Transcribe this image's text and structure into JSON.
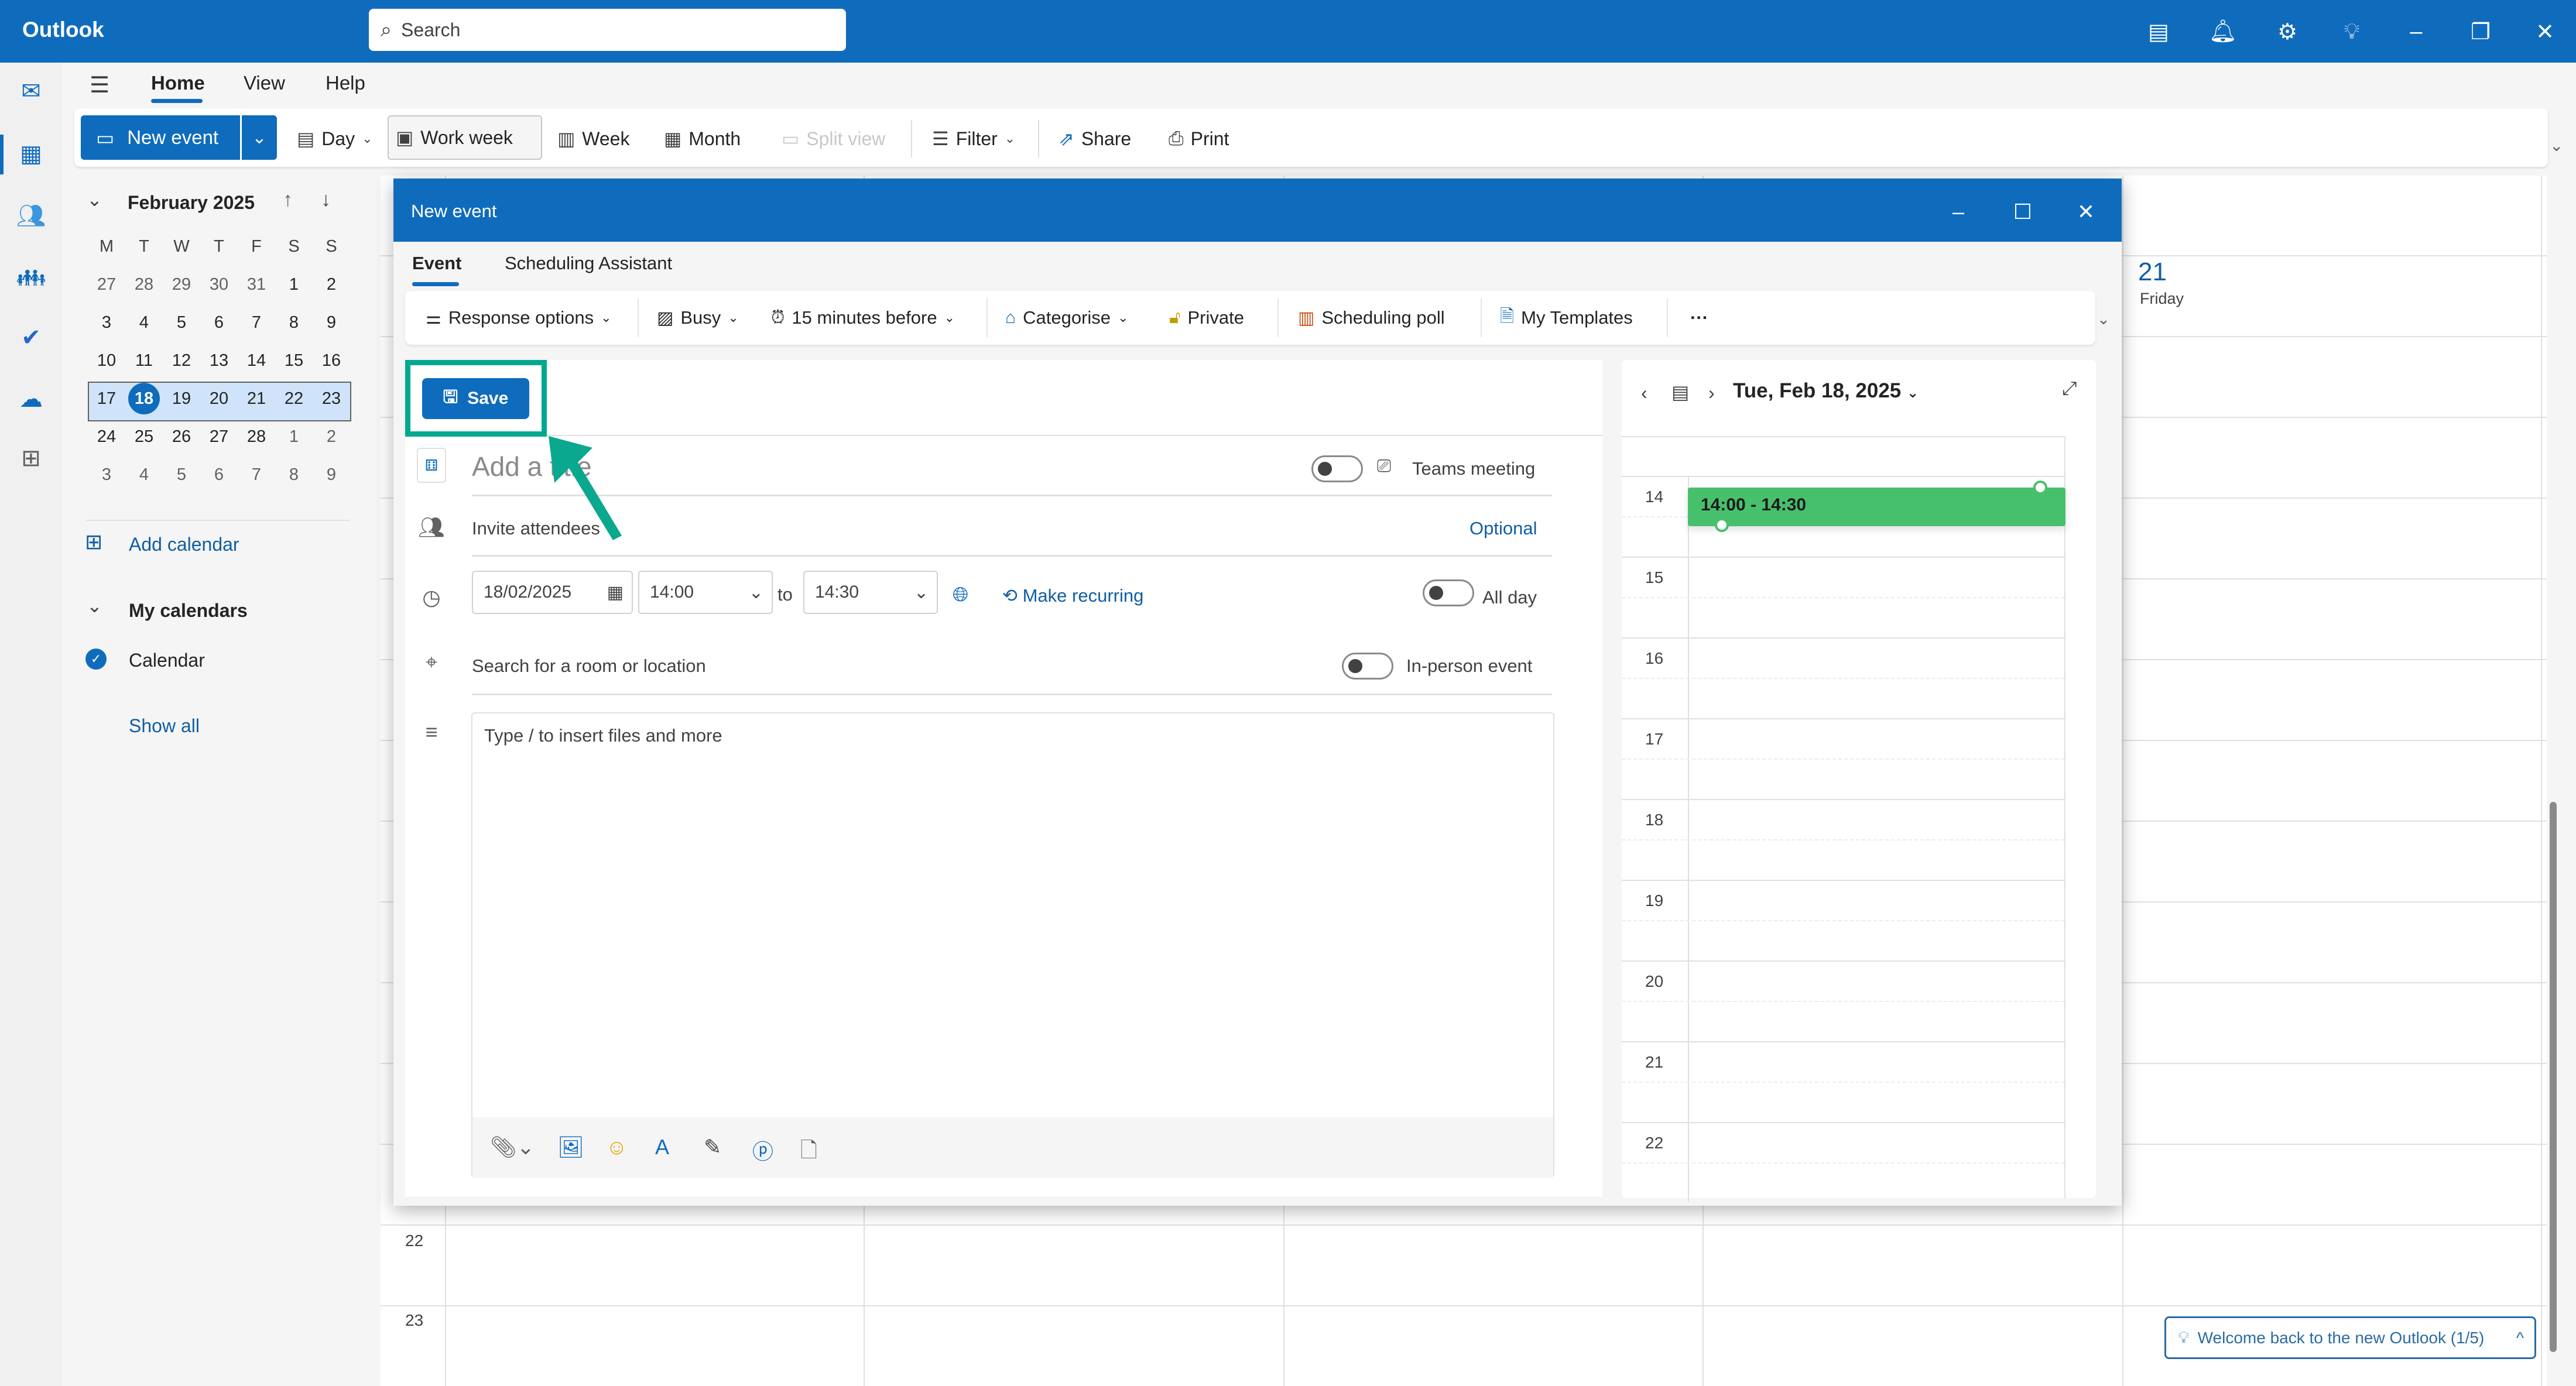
{
  "app": {
    "title": "Outlook",
    "search_placeholder": "Search"
  },
  "titlebar_icons": [
    "my-day-icon",
    "bell-icon",
    "gear-icon",
    "lightbulb-icon",
    "minimize-icon",
    "restore-icon",
    "close-icon"
  ],
  "nav": {
    "tabs": [
      "Home",
      "View",
      "Help"
    ],
    "active": "Home"
  },
  "ribbon": {
    "new_event": "New event",
    "day": "Day",
    "work_week": "Work week",
    "week": "Week",
    "month": "Month",
    "split_view": "Split view",
    "filter": "Filter",
    "share": "Share",
    "print": "Print"
  },
  "mini_calendar": {
    "month_label": "February 2025",
    "weekdays": [
      "M",
      "T",
      "W",
      "T",
      "F",
      "S",
      "S"
    ],
    "weeks": [
      [
        "27",
        "28",
        "29",
        "30",
        "31",
        "1",
        "2"
      ],
      [
        "3",
        "4",
        "5",
        "6",
        "7",
        "8",
        "9"
      ],
      [
        "10",
        "11",
        "12",
        "13",
        "14",
        "15",
        "16"
      ],
      [
        "17",
        "18",
        "19",
        "20",
        "21",
        "22",
        "23"
      ],
      [
        "24",
        "25",
        "26",
        "27",
        "28",
        "1",
        "2"
      ],
      [
        "3",
        "4",
        "5",
        "6",
        "7",
        "8",
        "9"
      ]
    ],
    "today": "18",
    "selected_week_index": 3
  },
  "sidebar": {
    "add_calendar": "Add calendar",
    "my_calendars": "My calendars",
    "calendar_item": "Calendar",
    "show_all": "Show all"
  },
  "background_calendar": {
    "day_number": "21",
    "day_name": "Friday",
    "hours": [
      "22",
      "23"
    ]
  },
  "modal": {
    "title": "New event",
    "tabs": [
      "Event",
      "Scheduling Assistant"
    ],
    "active_tab": "Event",
    "toolbar": {
      "response_options": "Response options",
      "busy": "Busy",
      "reminder": "15 minutes before",
      "categorise": "Categorise",
      "private": "Private",
      "scheduling_poll": "Scheduling poll",
      "my_templates": "My Templates",
      "more": "···"
    },
    "save": "Save",
    "title_placeholder": "Add a title",
    "teams_meeting": "Teams meeting",
    "invite_placeholder": "Invite attendees",
    "optional": "Optional",
    "date": "18/02/2025",
    "start_time": "14:00",
    "to": "to",
    "end_time": "14:30",
    "make_recurring": "Make recurring",
    "all_day": "All day",
    "location_placeholder": "Search for a room or location",
    "in_person": "In-person event",
    "body_placeholder": "Type / to insert files and more"
  },
  "day_pane": {
    "date_label": "Tue, Feb 18, 2025",
    "hours": [
      "14",
      "15",
      "16",
      "17",
      "18",
      "19",
      "20",
      "21",
      "22"
    ],
    "event_time": "14:00 - 14:30",
    "event_color": "#47c06d"
  },
  "welcome": {
    "text": "Welcome back to the new Outlook  (1/5)"
  },
  "colors": {
    "brand": "#0f6cbd",
    "highlight": "#00a88f"
  }
}
